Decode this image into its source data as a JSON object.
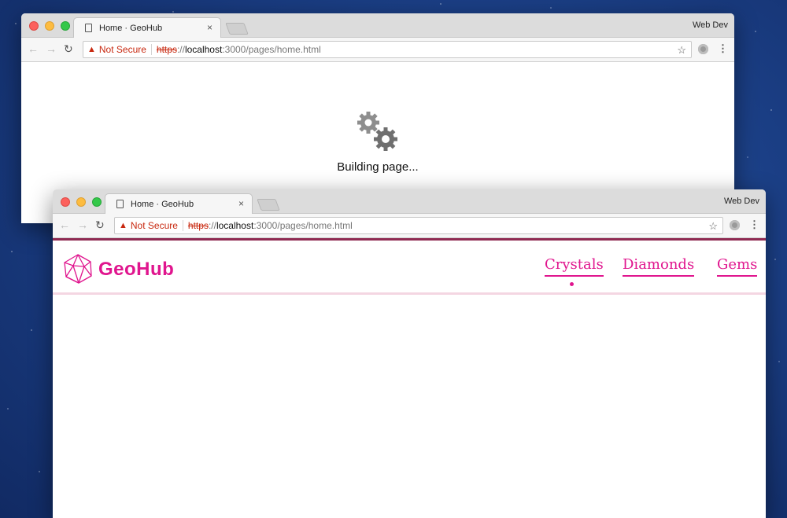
{
  "windows": {
    "back": {
      "tab_title": "Home · GeoHub",
      "tab_close": "×",
      "profile": "Web Dev",
      "security_label": "Not Secure",
      "url_protocol": "https",
      "url_host_sep": "://",
      "url_host": "localhost",
      "url_rest": ":3000/pages/home.html",
      "status_text": "Building page..."
    },
    "front": {
      "tab_title": "Home · GeoHub",
      "tab_close": "×",
      "profile": "Web Dev",
      "security_label": "Not Secure",
      "url_protocol": "https",
      "url_host_sep": "://",
      "url_host": "localhost",
      "url_rest": ":3000/pages/home.html"
    }
  },
  "site": {
    "brand": "GeoHub",
    "nav": [
      {
        "label": "Crystals",
        "active": true
      },
      {
        "label": "Diamonds",
        "active": false
      },
      {
        "label": "Gems",
        "active": false
      }
    ]
  },
  "icons": {
    "back": "←",
    "forward": "→",
    "reload": "↻",
    "warning": "▲",
    "star": "☆",
    "menu": "⋮"
  },
  "colors": {
    "accent": "#e0158e",
    "topbar": "#8f2a52",
    "warning": "#c8280f"
  }
}
